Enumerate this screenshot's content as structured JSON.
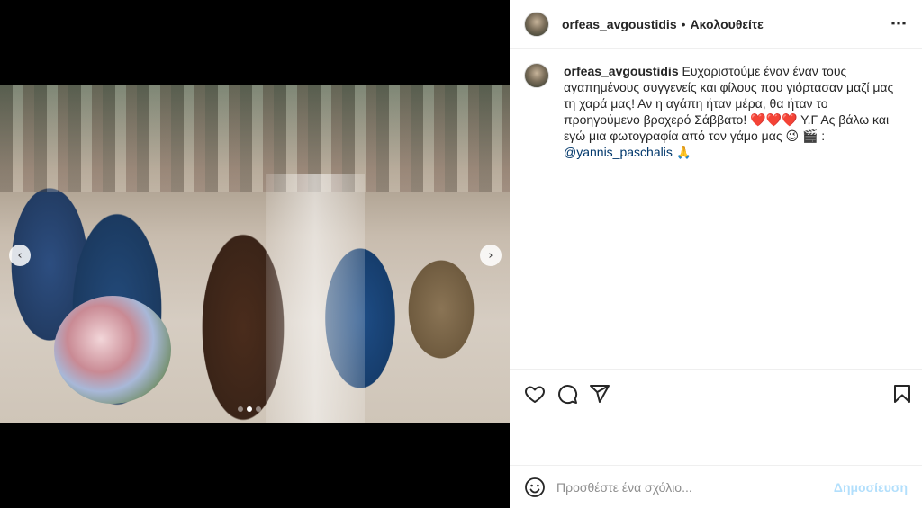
{
  "post": {
    "username": "orfeas_avgoustidis",
    "separator": "•",
    "follow_status": "Ακολουθείτε",
    "more_icon": "⋯",
    "caption": {
      "username": "orfeas_avgoustidis",
      "text_part1": "Ευχαριστούμε έναν έναν τους αγαπημένους συγγενείς και φίλους που γιόρτασαν μαζί μας τη χαρά μας! Αν η αγάπη ήταν μέρα, θα ήταν το προηγούμενο βροχερό Σάββατο!",
      "hearts": "❤️❤️❤️",
      "text_part2": "Υ.Γ Ας βάλω και εγώ μια φωτογραφία από τον γάμο μας",
      "emoji_wink": "😉",
      "emoji_clapper": "🎬",
      "credit_sep": ":",
      "mention": "@yannis_paschalis",
      "emoji_pray": "🙏"
    }
  },
  "media": {
    "prev_icon": "‹",
    "next_icon": "›",
    "total_slides": 3,
    "active_slide": 2
  },
  "comment": {
    "placeholder": "Προσθέστε ένα σχόλιο...",
    "post_label": "Δημοσίευση"
  },
  "colors": {
    "accent_blue_disabled": "#b2dffc",
    "mention": "#00376b",
    "text": "#262626",
    "muted": "#8e8e8e"
  }
}
